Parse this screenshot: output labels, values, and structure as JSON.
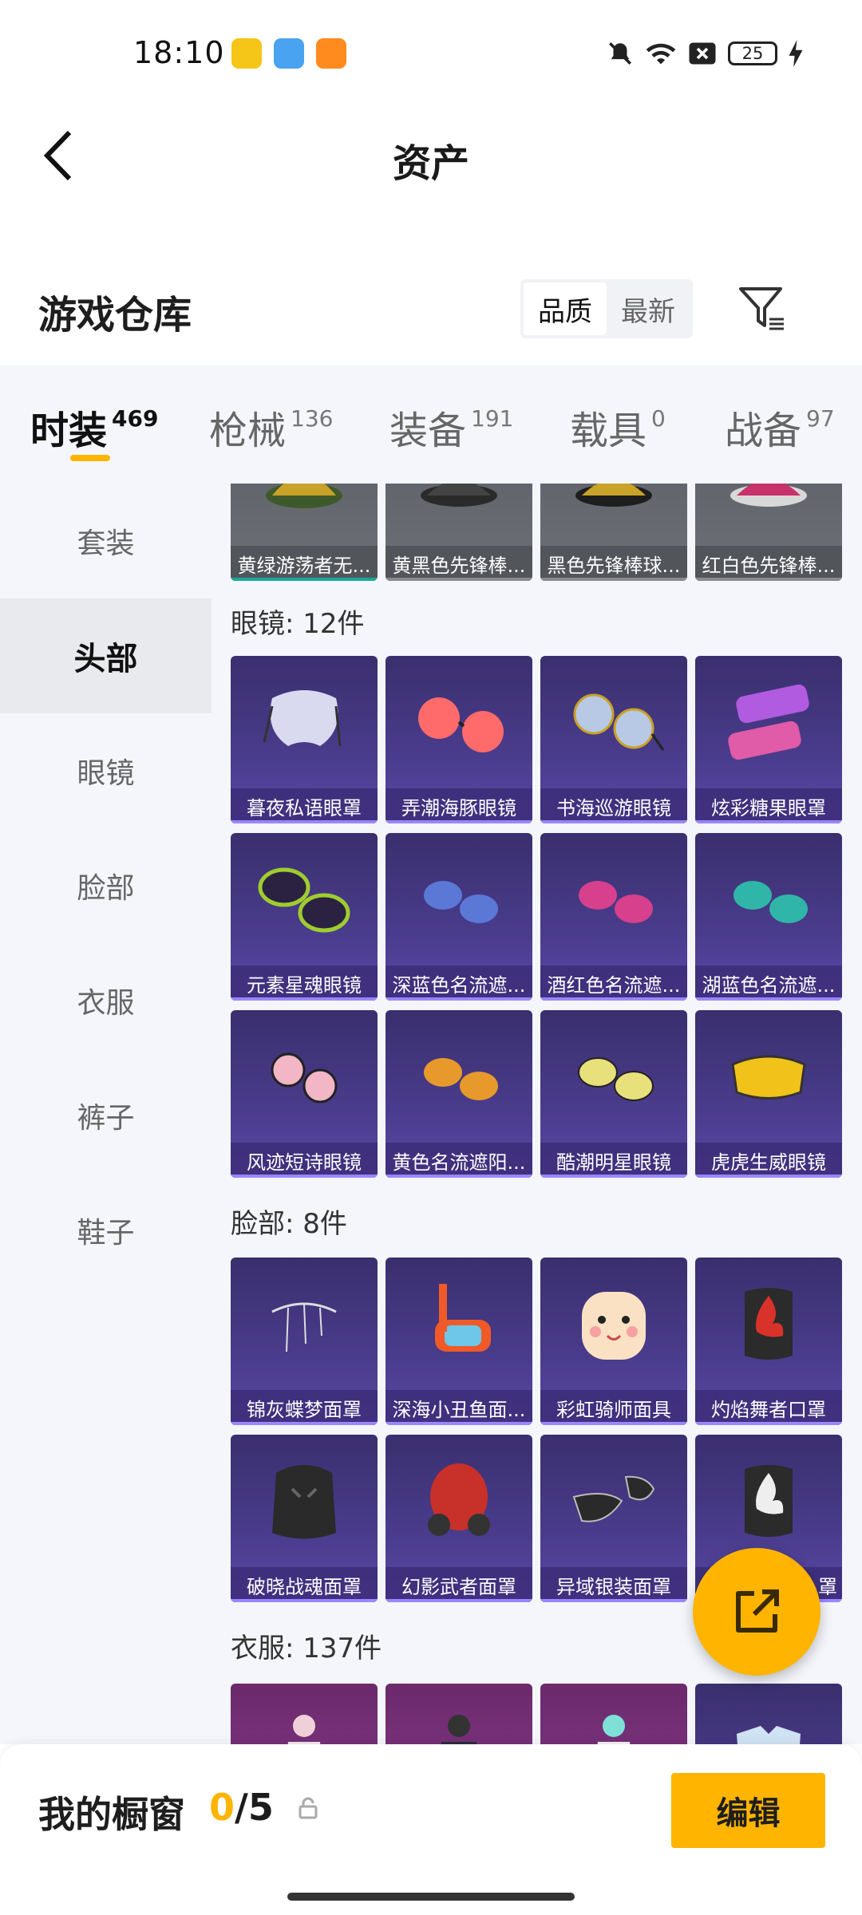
{
  "status_bar": {
    "time": "18:10",
    "battery": "25",
    "icons": [
      "mute-icon",
      "wifi-icon",
      "sim-off-icon",
      "battery-icon",
      "charging-icon"
    ]
  },
  "header": {
    "title": "资产"
  },
  "warehouse": {
    "title": "游戏仓库",
    "sort_options": [
      "品质",
      "最新"
    ],
    "active_sort": "品质"
  },
  "tabs": [
    {
      "label": "时装",
      "count": "469"
    },
    {
      "label": "枪械",
      "count": "136"
    },
    {
      "label": "装备",
      "count": "191"
    },
    {
      "label": "载具",
      "count": "0"
    },
    {
      "label": "战备",
      "count": "97"
    }
  ],
  "sidebar": [
    "套装",
    "头部",
    "眼镜",
    "脸部",
    "衣服",
    "裤子",
    "鞋子"
  ],
  "head_row": [
    "黄绿游荡者无...",
    "黄黑色先锋棒...",
    "黑色先锋棒球...",
    "红白色先锋棒..."
  ],
  "glasses": {
    "title": "眼镜: 12件",
    "items": [
      "暮夜私语眼罩",
      "弄潮海豚眼镜",
      "书海巡游眼镜",
      "炫彩糖果眼罩",
      "元素星魂眼镜",
      "深蓝色名流遮...",
      "酒红色名流遮...",
      "湖蓝色名流遮...",
      "风迹短诗眼镜",
      "黄色名流遮阳...",
      "酷潮明星眼镜",
      "虎虎生威眼镜"
    ]
  },
  "face": {
    "title": "脸部: 8件",
    "items": [
      "锦灰蝶梦面罩",
      "深海小丑鱼面...",
      "彩虹骑师面具",
      "灼焰舞者口罩",
      "破晓战魂面罩",
      "幻影武者面罩",
      "异域银装面罩",
      "罩"
    ]
  },
  "clothes": {
    "title": "衣服: 137件"
  },
  "bottom": {
    "title": "我的橱窗",
    "count_current": "0",
    "count_total": "/5",
    "edit_label": "编辑"
  },
  "colors": {
    "accent": "#ffb400",
    "card_purple": "#4a3c8c"
  }
}
